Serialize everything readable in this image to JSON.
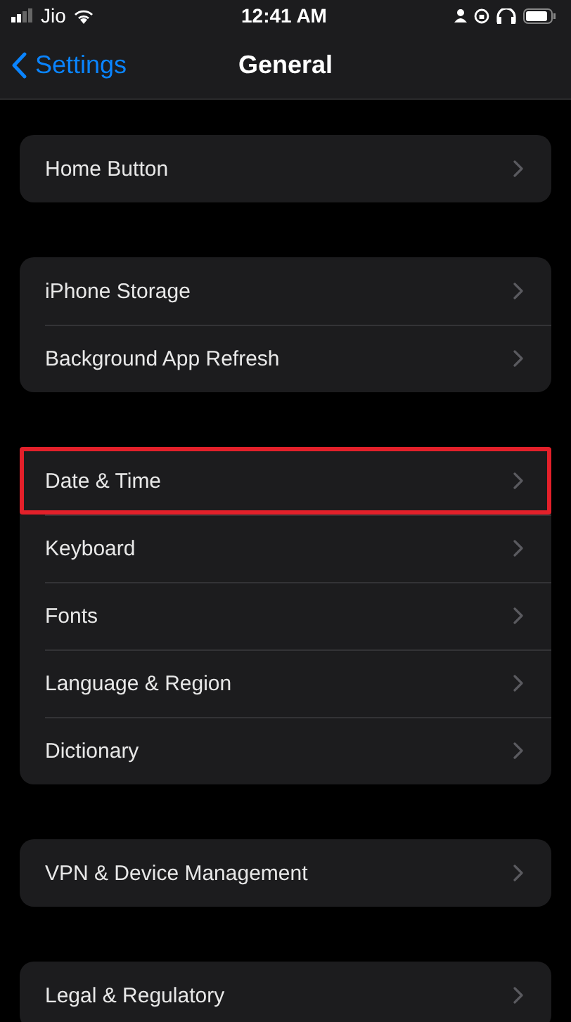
{
  "status_bar": {
    "carrier": "Jio",
    "time": "12:41 AM"
  },
  "nav": {
    "back": "Settings",
    "title": "General"
  },
  "groups": [
    {
      "rows": [
        {
          "label": "Home Button",
          "highlighted": false
        }
      ]
    },
    {
      "rows": [
        {
          "label": "iPhone Storage",
          "highlighted": false
        },
        {
          "label": "Background App Refresh",
          "highlighted": false
        }
      ]
    },
    {
      "rows": [
        {
          "label": "Date & Time",
          "highlighted": true
        },
        {
          "label": "Keyboard",
          "highlighted": false
        },
        {
          "label": "Fonts",
          "highlighted": false
        },
        {
          "label": "Language & Region",
          "highlighted": false
        },
        {
          "label": "Dictionary",
          "highlighted": false
        }
      ]
    },
    {
      "rows": [
        {
          "label": "VPN & Device Management",
          "highlighted": false
        }
      ]
    },
    {
      "rows": [
        {
          "label": "Legal & Regulatory",
          "highlighted": false
        }
      ]
    }
  ]
}
